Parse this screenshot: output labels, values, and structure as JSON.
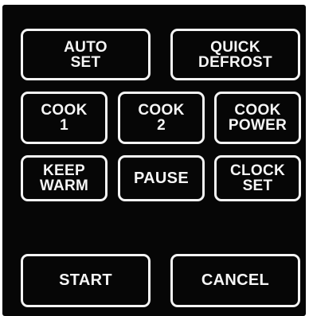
{
  "keypad": {
    "auto_set": {
      "line1": "AUTO",
      "line2": "SET"
    },
    "quick_defrost": {
      "line1": "QUICK",
      "line2": "DEFROST"
    },
    "cook_1": {
      "line1": "COOK",
      "line2": "1"
    },
    "cook_2": {
      "line1": "COOK",
      "line2": "2"
    },
    "cook_power": {
      "line1": "COOK",
      "line2": "POWER"
    },
    "keep_warm": {
      "line1": "KEEP",
      "line2": "WARM"
    },
    "pause": {
      "label": "PAUSE"
    },
    "clock_set": {
      "line1": "CLOCK",
      "line2": "SET"
    },
    "start": {
      "label": "START"
    },
    "cancel": {
      "label": "CANCEL"
    }
  },
  "colors": {
    "panel": "#060606",
    "key_border": "#f4f4f4",
    "key_text": "#f6f6f6"
  }
}
